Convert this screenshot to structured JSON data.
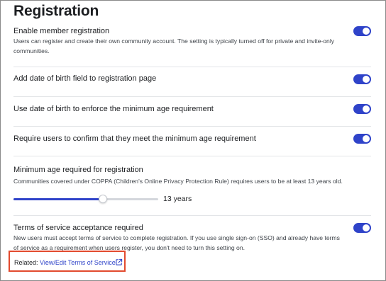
{
  "page": {
    "title": "Registration"
  },
  "settings": [
    {
      "title": "Enable member registration",
      "description": "Users can register and create their own community account. The setting is typically turned off for private and invite-only communities.",
      "enabled": true
    },
    {
      "title": "Add date of birth field to registration page",
      "enabled": true
    },
    {
      "title": "Use date of birth to enforce the minimum age requirement",
      "enabled": true
    },
    {
      "title": "Require users to confirm that they meet the minimum age requirement",
      "enabled": true
    }
  ],
  "min_age": {
    "title": "Minimum age required for registration",
    "description": "Communities covered under COPPA (Children's Online Privacy Protection Rule) requires users to be at least 13 years old.",
    "value_label": "13 years",
    "slider_fraction": 0.62
  },
  "terms": {
    "title": "Terms of service acceptance required",
    "description": "New users must accept terms of service to complete registration. If you use single sign-on (SSO) and already have terms of service as a requirement when users register, you don't need to turn this setting on.",
    "enabled": true,
    "related_label": "Related:",
    "link_text": "View/Edit Terms of Service",
    "link_icon": "external-link-icon"
  },
  "colors": {
    "accent": "#2f43c9",
    "highlight_border": "#e24a2e"
  }
}
